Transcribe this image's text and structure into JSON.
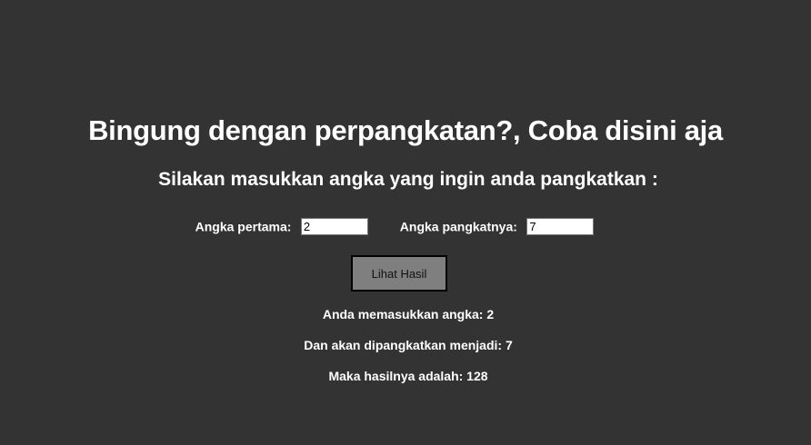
{
  "heading": {
    "title": "Bingung dengan perpangkatan?, Coba disini aja",
    "subtitle": "Silakan masukkan angka yang ingin anda pangkatkan :"
  },
  "form": {
    "base_label": "Angka pertama:",
    "base_value": "2",
    "exponent_label": "Angka pangkatnya:",
    "exponent_value": "7",
    "submit_label": "Lihat Hasil"
  },
  "results": {
    "line1": "Anda memasukkan angka: 2",
    "line2": "Dan akan dipangkatkan menjadi: 7",
    "line3": "Maka hasilnya adalah: 128"
  },
  "colors": {
    "background": "#333333",
    "text": "#ffffff",
    "button_bg": "#7f7f7f"
  }
}
